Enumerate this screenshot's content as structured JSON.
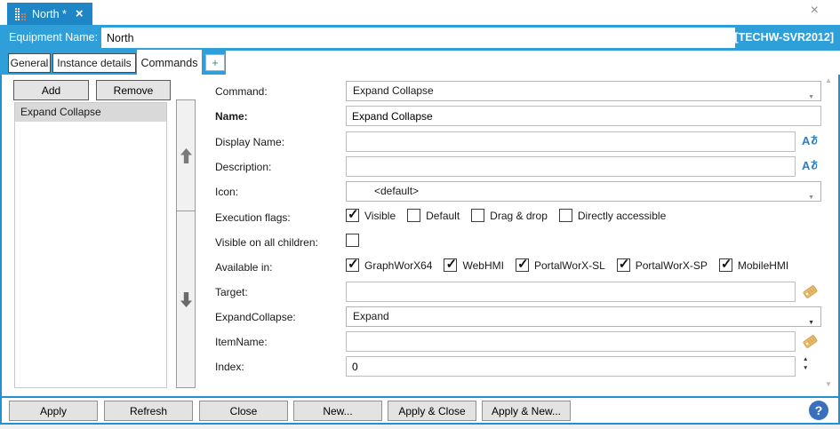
{
  "colors": {
    "bar_blue": "#2e9fd8",
    "doc_tab_blue": "#1f86c6",
    "border_blue": "#2191d0",
    "help_blue": "#3a6fbd",
    "locale_icon_blue": "#2f7cc0",
    "tag_icon_gold": "#ebbc69",
    "selected_item_gray": "#d9d9d9"
  },
  "title_tab": {
    "label": "North *"
  },
  "icons": {
    "doc_tab_close": "×",
    "window_close": "×",
    "dropdown_arrow": "▼",
    "spin_up": "▲",
    "spin_down": "▼",
    "scroll_up": "▲",
    "scroll_down": "▼",
    "locale_icon_text": "Aあ",
    "locale_icon_label": "A",
    "plus": "+"
  },
  "equipment_bar": {
    "label": "Equipment Name:",
    "value": "North",
    "server_badge": "[TECHW-SVR2012]"
  },
  "tab_strip": {
    "tabs": [
      {
        "label": "General",
        "active": false
      },
      {
        "label": "Instance details",
        "active": false
      },
      {
        "label": "Commands",
        "active": true
      }
    ],
    "plus_tab": "+"
  },
  "list_panel": {
    "add_label": "Add",
    "remove_label": "Remove",
    "items": [
      "Expand Collapse"
    ],
    "selected": "Expand Collapse"
  },
  "form": {
    "command": {
      "label": "Command:",
      "value": "Expand Collapse"
    },
    "name": {
      "label": "Name:",
      "value": "Expand Collapse"
    },
    "display_name": {
      "label": "Display Name:",
      "value": ""
    },
    "description": {
      "label": "Description:",
      "value": ""
    },
    "icon": {
      "label": "Icon:",
      "value": "<default>"
    },
    "execution_flags": {
      "label": "Execution flags:",
      "options": [
        {
          "label": "Visible",
          "checked": true
        },
        {
          "label": "Default",
          "checked": false
        },
        {
          "label": "Drag & drop",
          "checked": false
        },
        {
          "label": "Directly accessible",
          "checked": false
        }
      ]
    },
    "visible_on_all_children": {
      "label": "Visible on all children:",
      "checked": false
    },
    "available_in": {
      "label": "Available in:",
      "options": [
        {
          "label": "GraphWorX64",
          "checked": true
        },
        {
          "label": "WebHMI",
          "checked": true
        },
        {
          "label": "PortalWorX-SL",
          "checked": true
        },
        {
          "label": "PortalWorX-SP",
          "checked": true
        },
        {
          "label": "MobileHMI",
          "checked": true
        }
      ]
    },
    "target": {
      "label": "Target:",
      "value": ""
    },
    "expand_collapse": {
      "label": "ExpandCollapse:",
      "value": "Expand"
    },
    "item_name": {
      "label": "ItemName:",
      "value": ""
    },
    "index": {
      "label": "Index:",
      "value": "0"
    }
  },
  "footer": {
    "buttons": [
      "Apply",
      "Refresh",
      "Close",
      "New...",
      "Apply & Close",
      "Apply & New..."
    ],
    "help": "?"
  }
}
